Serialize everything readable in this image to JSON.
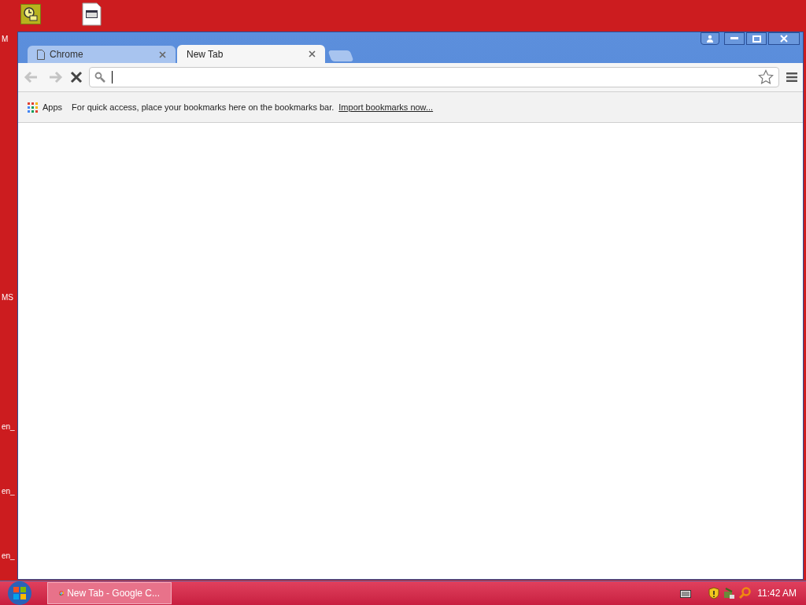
{
  "desktop": {
    "edge_labels": [
      "M",
      "MS",
      "en_",
      "en_",
      "en_"
    ]
  },
  "window": {
    "tabs": [
      {
        "title": "Chrome",
        "selected": false
      },
      {
        "title": "New Tab",
        "selected": true
      }
    ],
    "toolbar": {
      "back": {
        "disabled": true
      },
      "forward": {
        "disabled": true
      }
    },
    "bookmarks_bar": {
      "apps_label": "Apps",
      "message": "For quick access, place your bookmarks here on the bookmarks bar.",
      "import_link": "Import bookmarks now..."
    }
  },
  "taskbar": {
    "buttons": [
      {
        "label": "New Tab - Google C...",
        "selected": true
      }
    ],
    "clock": "11:42 AM"
  }
}
